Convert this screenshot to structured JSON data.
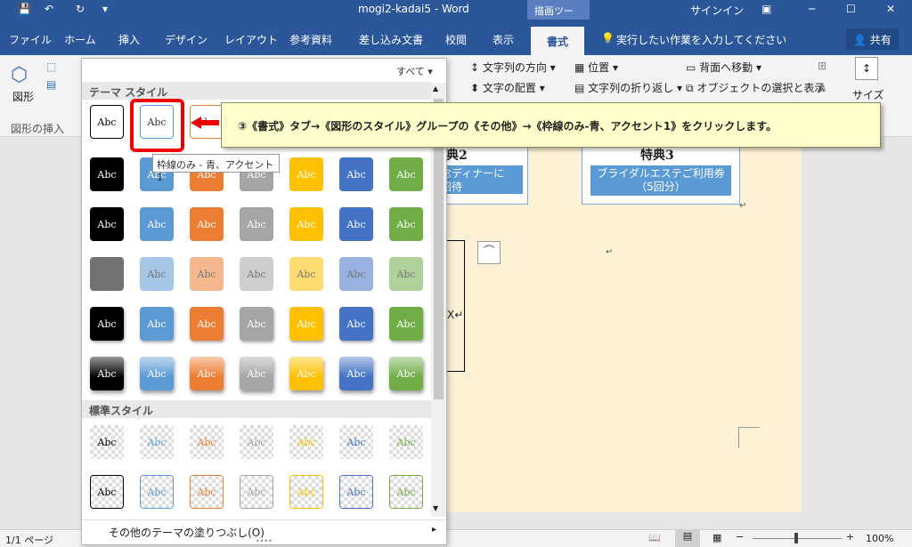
{
  "title_bar": {
    "doc_title": "mogi2-kadai5  -  Word",
    "context_tab": "描画ツール",
    "signin": "サインイン"
  },
  "tabs": [
    "ファイル",
    "ホーム",
    "挿入",
    "デザイン",
    "レイアウト",
    "参考資料",
    "差し込み文書",
    "校閲",
    "表示",
    "書式"
  ],
  "active_tab": "書式",
  "tell_me": "実行したい作業を入力してください",
  "share": "共有",
  "ribbon": {
    "shapes_label": "図形",
    "insert_shapes_group": "図形の挿入",
    "text_direction": "文字列の方向",
    "text_align": "文字の配置",
    "position": "位置",
    "wrap_text": "文字列の折り返し",
    "bring_forward": "背面へ移動",
    "selection_pane": "オブジェクトの選択と表示",
    "size": "サイズ"
  },
  "gallery": {
    "filter": "すべて",
    "theme_header": "テーマ スタイル",
    "standard_header": "標準スタイル",
    "swatch_text": "Abc",
    "more_fills": "その他のテーマの塗りつぶし(O)",
    "tooltip": "枠線のみ - 青、アクセント 1"
  },
  "callout": "③《書式》タブ→《図形のスタイル》グループの《その他》→《枠線のみ-青、アクセント1》をクリックします。",
  "document": {
    "special2_title": "典2",
    "special2_text1": "念ディナーに",
    "special2_text2": "招待",
    "special3_title": "特典3",
    "special3_text1": "ブライダルエステご利用券",
    "special3_text2": "（5回分）",
    "x_mark": "X↵"
  },
  "status": {
    "page": "1/1 ページ",
    "zoom": "100%"
  },
  "colors": {
    "accent": "#2b579a",
    "swatch_palette": [
      "#000000",
      "#5b9bd5",
      "#ed7d31",
      "#a5a5a5",
      "#ffc000",
      "#4472c4",
      "#70ad47"
    ]
  }
}
